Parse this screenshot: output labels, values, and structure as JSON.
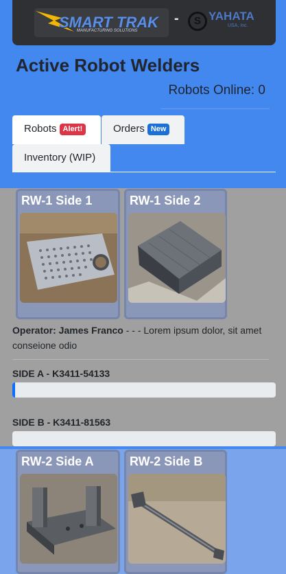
{
  "header": {
    "logo_main": "SMART TRAK",
    "logo_sub": "MANUFACTURING SOLUTIONS",
    "separator": "-",
    "partner_mark": "S",
    "partner_name": "YAHATA",
    "partner_sub": "USA, Inc.",
    "title": "Active Robot Welders",
    "robots_online": "Robots Online: 0"
  },
  "tabs": [
    {
      "label": "Robots",
      "badge": "Alert!",
      "badge_color": "#dc3545",
      "active": true
    },
    {
      "label": "Orders",
      "badge": "New",
      "badge_color": "#1b6fd6",
      "active": false
    },
    {
      "label": "Inventory (WIP)",
      "badge": "",
      "active": false
    }
  ],
  "welders": [
    {
      "cards": [
        {
          "title": "RW-1 Side 1",
          "image": "perforated-plate-photo"
        },
        {
          "title": "RW-1 Side 2",
          "image": "metal-box-photo"
        }
      ],
      "operator_label": "Operator: James Franco",
      "operator_note": " - - - Lorem ipsum dolor, sit amet conseione odio",
      "sides": [
        {
          "label": "SIDE A - K3411-54133",
          "progress": 0.01
        },
        {
          "label": "SIDE B - K3411-81563",
          "progress": 0.0
        }
      ]
    },
    {
      "cards": [
        {
          "title": "RW-2 Side A",
          "image": "bracket-photo"
        },
        {
          "title": "RW-2 Side B",
          "image": "rod-arm-photo"
        }
      ]
    }
  ],
  "colors": {
    "header_bg": "#4288ee",
    "active_section_bg": "#a0a0a0",
    "idle_section_bg": "#7aa5ec",
    "progress_fill": "#0d6efd"
  }
}
